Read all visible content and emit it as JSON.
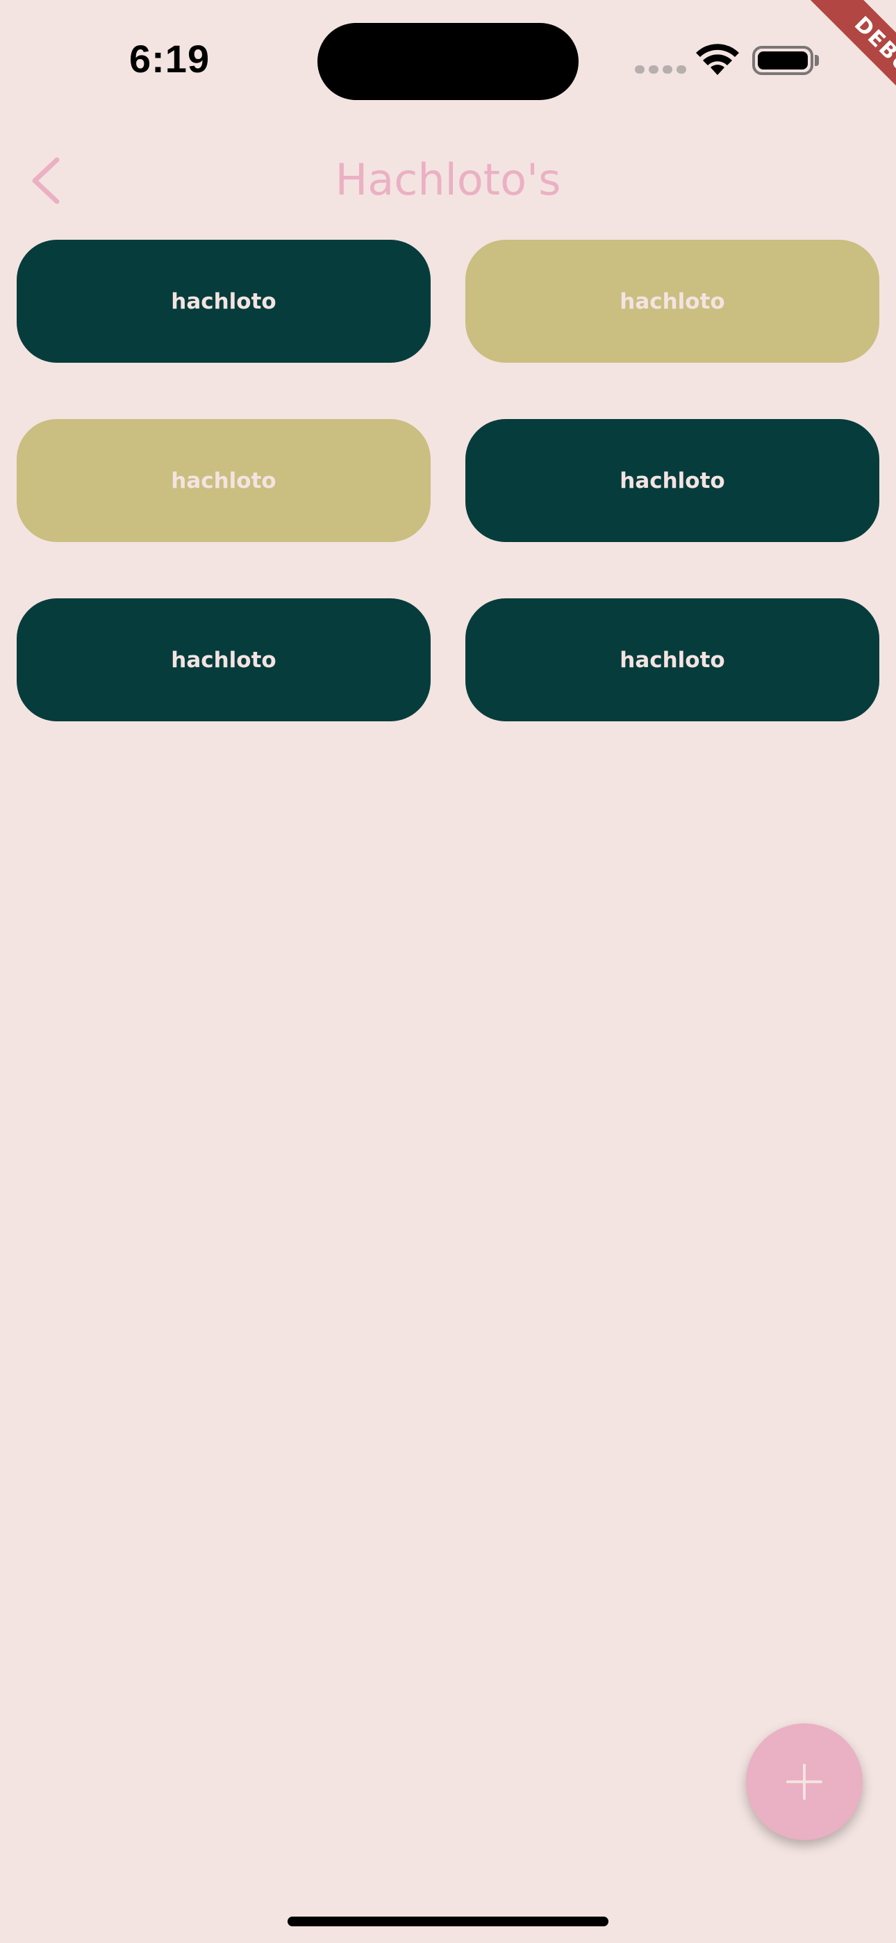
{
  "status_bar": {
    "time": "6:19",
    "signal_icon": "cellular-signal-icon",
    "wifi_icon": "wifi-icon",
    "battery_icon": "battery-icon"
  },
  "debug_banner": {
    "label": "DEBUG",
    "color": "#B14643"
  },
  "app_bar": {
    "title": "Hachloto's",
    "back_icon": "chevron-left-icon",
    "title_color": "#EBB0C4"
  },
  "tiles": [
    {
      "label": "hachloto",
      "style": "dark",
      "color": "#073C3C"
    },
    {
      "label": "hachloto",
      "style": "tan",
      "color": "#CABE81"
    },
    {
      "label": "hachloto",
      "style": "tan",
      "color": "#CABE81"
    },
    {
      "label": "hachloto",
      "style": "dark",
      "color": "#073C3C"
    },
    {
      "label": "hachloto",
      "style": "dark",
      "color": "#073C3C"
    },
    {
      "label": "hachloto",
      "style": "dark",
      "color": "#073C3C"
    }
  ],
  "fab": {
    "icon": "plus-icon",
    "color": "#EAB0C3"
  },
  "colors": {
    "background": "#F3E4E1",
    "tile_text": "#F3E4E1"
  }
}
